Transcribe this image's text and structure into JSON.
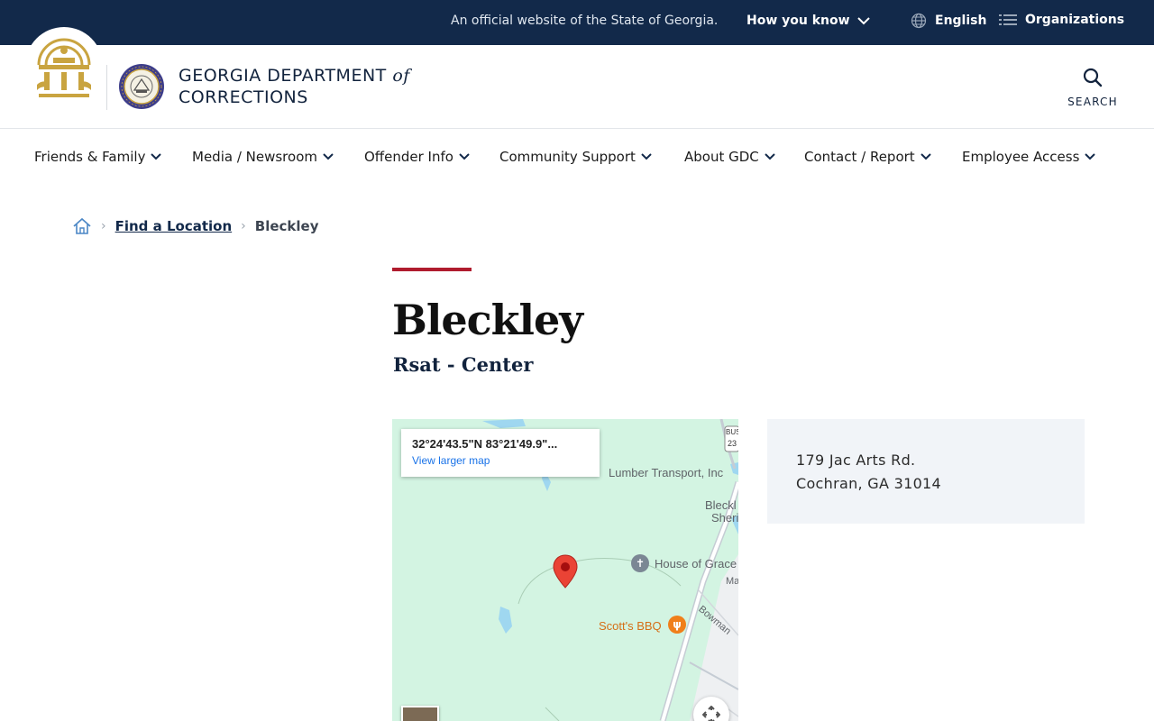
{
  "banner": {
    "official_text": "An official website of the State of Georgia.",
    "how_you_know": "How you know",
    "language": "English",
    "organizations": "Organizations"
  },
  "header": {
    "brand_line1": "GEORGIA DEPARTMENT",
    "brand_of": "of",
    "brand_line2": "CORRECTIONS",
    "search_label": "SEARCH"
  },
  "nav": {
    "items": [
      {
        "label": "Friends & Family"
      },
      {
        "label": "Media / Newsroom"
      },
      {
        "label": "Offender Info"
      },
      {
        "label": "Community Support"
      },
      {
        "label": "About GDC"
      },
      {
        "label": "Contact / Report"
      },
      {
        "label": "Employee Access"
      }
    ]
  },
  "breadcrumb": {
    "home_icon": "home-icon",
    "link": "Find a Location",
    "current": "Bleckley"
  },
  "page": {
    "title": "Bleckley",
    "subtitle": "Rsat - Center"
  },
  "map": {
    "coords": "32°24'43.5\"N 83°21'49.9\"...",
    "view_larger": "View larger map",
    "labels": {
      "lumber": "Lumber Transport, Inc",
      "bleckley_sheriff_1": "Bleckl",
      "bleckley_sheriff_2": "Sheri",
      "house_of_grace": "House of Grace",
      "scotts_bbq": "Scott's BBQ",
      "bowman": "Bowman",
      "ma": "Ma",
      "bus": "BUS",
      "route": "23"
    },
    "colors": {
      "land": "#d3f4e2",
      "water": "#9fd7f0",
      "pin": "#ea4335"
    }
  },
  "address": {
    "line1": "179 Jac Arts Rd.",
    "line2": "Cochran, GA 31014"
  },
  "colors": {
    "banner_bg": "#12294a",
    "accent_red": "#b01c2e",
    "address_bg": "#f1f4f8"
  }
}
